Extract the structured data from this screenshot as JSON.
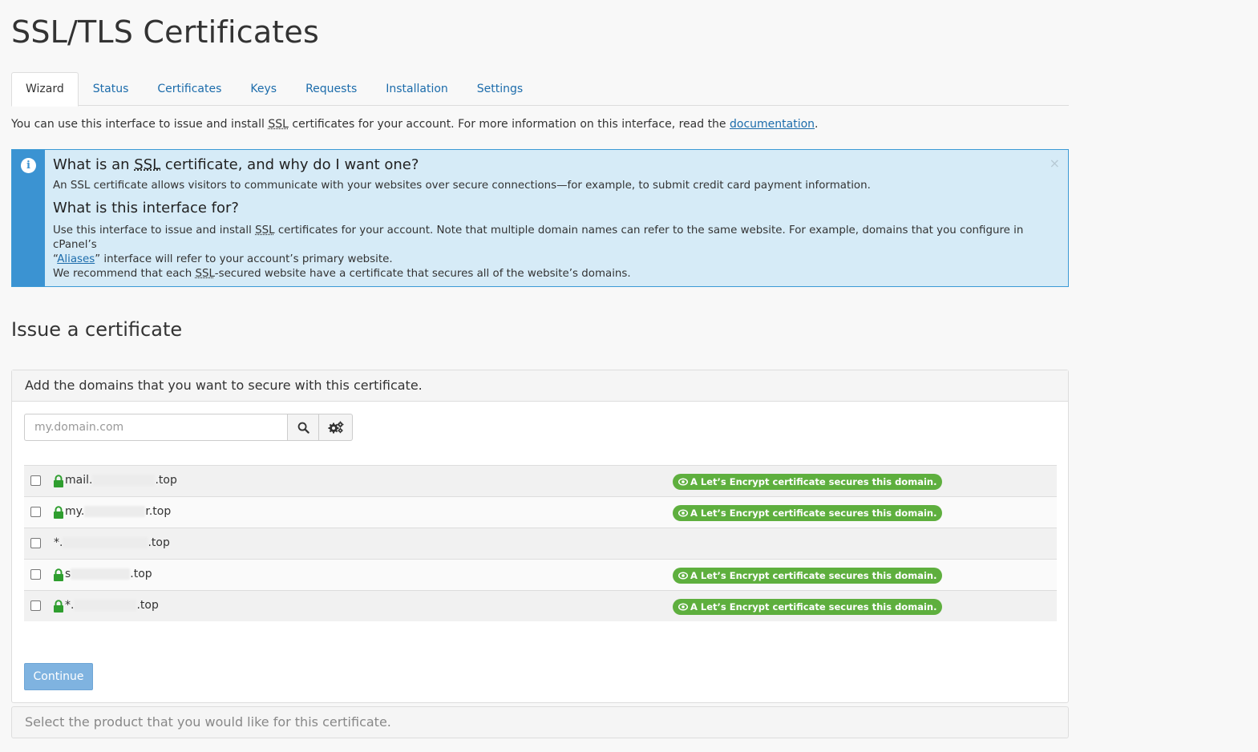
{
  "page": {
    "title": "SSL/TLS Certificates"
  },
  "tabs": [
    {
      "label": "Wizard",
      "active": true
    },
    {
      "label": "Status"
    },
    {
      "label": "Certificates"
    },
    {
      "label": "Keys"
    },
    {
      "label": "Requests"
    },
    {
      "label": "Installation"
    },
    {
      "label": "Settings"
    }
  ],
  "intro": {
    "prefix": "You can use this interface to issue and install ",
    "abbr": "SSL",
    "suffix": " certificates for your account. For more information on this interface, read the ",
    "link": "documentation",
    "end": "."
  },
  "info_alert": {
    "heading1_prefix": "What is an ",
    "heading1_abbr": "SSL",
    "heading1_suffix": " certificate, and why do I want one?",
    "p1": "An SSL certificate allows visitors to communicate with your websites over secure connections—for example, to submit credit card payment information.",
    "heading2": "What is this interface for?",
    "p2_prefix": "Use this interface to issue and install ",
    "p2_abbr": "SSL",
    "p2_suffix": " certificates for your account. Note that multiple domain names can refer to the same website. For example, domains that you configure in cPanel’s",
    "p3_prefix": "“",
    "p3_link": "Aliases",
    "p3_suffix": "” interface will refer to your account’s primary website.",
    "p4_prefix": "We recommend that each ",
    "p4_abbr": "SSL",
    "p4_suffix": "-secured website have a certificate that secures all of the website’s domains.",
    "close": "×",
    "accent": "#3b93d2"
  },
  "issue": {
    "heading": "Issue a certificate",
    "panel_heading": "Add the domains that you want to secure with this certificate.",
    "search_placeholder": "my.domain.com",
    "search_icon": "search-icon",
    "settings_icon": "gears-icon",
    "domains": [
      {
        "prefix": "mail.",
        "suffix": ".top",
        "secured": true,
        "badge": "A Let’s Encrypt certificate secures this domain."
      },
      {
        "prefix": "my.",
        "suffix": "r.top",
        "secured": true,
        "badge": "A Let’s Encrypt certificate secures this domain."
      },
      {
        "prefix": "*.",
        "suffix": ".top",
        "secured": false,
        "badge": ""
      },
      {
        "prefix": "s",
        "suffix": ".top",
        "secured": true,
        "badge": "A Let’s Encrypt certificate secures this domain."
      },
      {
        "prefix": "*.",
        "suffix": ".top",
        "secured": true,
        "badge": "A Let’s Encrypt certificate secures this domain."
      }
    ],
    "continue_label": "Continue",
    "badge_color": "#5eaf3e"
  },
  "product_panel": {
    "heading": "Select the product that you would like for this certificate."
  }
}
